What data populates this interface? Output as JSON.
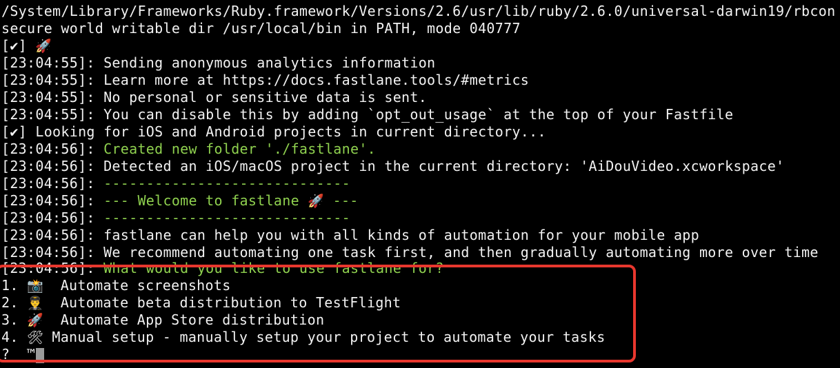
{
  "terminal": {
    "lines": [
      {
        "prefix": "",
        "text": "/System/Library/Frameworks/Ruby.framework/Versions/2.6/usr/lib/ruby/2.6.0/universal-darwin19/rbcon",
        "color": "default"
      },
      {
        "prefix": "",
        "text": "secure world writable dir /usr/local/bin in PATH, mode 040777",
        "color": "default"
      },
      {
        "prefix": "[✔] ",
        "text": "",
        "emoji": "🚀",
        "color": "default"
      },
      {
        "prefix": "[23:04:55]: ",
        "text": "Sending anonymous analytics information",
        "color": "default"
      },
      {
        "prefix": "[23:04:55]: ",
        "text": "Learn more at https://docs.fastlane.tools/#metrics",
        "color": "default"
      },
      {
        "prefix": "[23:04:55]: ",
        "text": "No personal or sensitive data is sent.",
        "color": "default"
      },
      {
        "prefix": "[23:04:55]: ",
        "text": "You can disable this by adding `opt_out_usage` at the top of your Fastfile",
        "color": "default"
      },
      {
        "prefix": "[✔] ",
        "text": "Looking for iOS and Android projects in current directory...",
        "color": "default"
      },
      {
        "prefix": "[23:04:56]: ",
        "text": "Created new folder './fastlane'.",
        "color": "green"
      },
      {
        "prefix": "[23:04:56]: ",
        "text": "Detected an iOS/macOS project in the current directory: 'AiDouVideo.xcworkspace'",
        "color": "default"
      },
      {
        "prefix": "[23:04:56]: ",
        "text": "-----------------------------",
        "color": "green"
      },
      {
        "prefix": "[23:04:56]: ",
        "text": "--- Welcome to fastlane ",
        "emoji": "🚀",
        "suffix": " ---",
        "color": "green"
      },
      {
        "prefix": "[23:04:56]: ",
        "text": "-----------------------------",
        "color": "green"
      },
      {
        "prefix": "[23:04:56]: ",
        "text": "fastlane can help you with all kinds of automation for your mobile app",
        "color": "default"
      },
      {
        "prefix": "[23:04:56]: ",
        "text": "We recommend automating one task first, and then gradually automating more over time",
        "color": "default"
      },
      {
        "prefix": "[23:04:56]: ",
        "text": "What would you like to use fastlane for?",
        "color": "green"
      }
    ],
    "options": [
      {
        "number": "1.",
        "emoji": "📸",
        "label": " Automate screenshots"
      },
      {
        "number": "2.",
        "emoji": "👨‍✈️",
        "label": " Automate beta distribution to TestFlight"
      },
      {
        "number": "3.",
        "emoji": "🚀",
        "label": " Automate App Store distribution"
      },
      {
        "number": "4.",
        "emoji": "🛠",
        "label": "Manual setup - manually setup your project to automate your tasks"
      }
    ],
    "prompt": {
      "symbol": "?",
      "input": "™"
    },
    "colors": {
      "background": "#000000",
      "text": "#f2f2f2",
      "green": "#8fd14f",
      "highlight_border": "#e8372e",
      "cursor": "#9a9a9a"
    }
  }
}
